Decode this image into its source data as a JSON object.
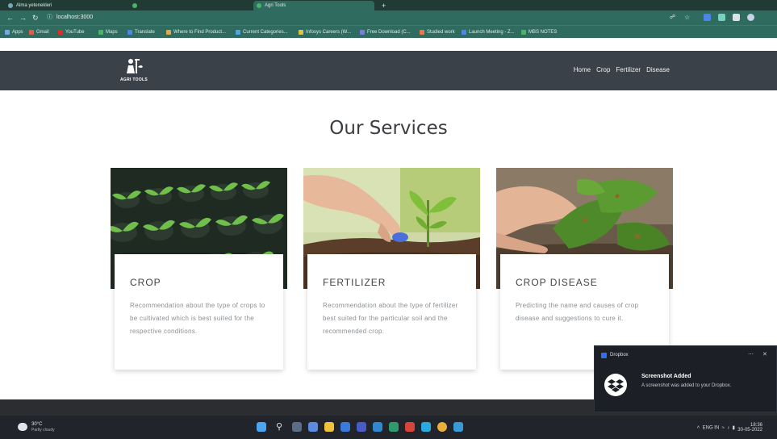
{
  "browser": {
    "tabs": [
      {
        "label": "Alma yetenekleri",
        "active": false
      },
      {
        "label": "",
        "active": false
      },
      {
        "label": "Agri Tools",
        "active": true
      }
    ],
    "url": "localhost:3000",
    "bookmarks": [
      {
        "label": "Apps",
        "color": "#7aa6e0"
      },
      {
        "label": "Gmail",
        "color": "#e05a4a"
      },
      {
        "label": "YouTube",
        "color": "#e02a2a"
      },
      {
        "label": "Maps",
        "color": "#4ab36a"
      },
      {
        "label": "Translate",
        "color": "#4a86e8"
      },
      {
        "label": "Where to Find Product...",
        "color": "#e0a84a"
      },
      {
        "label": "Current Categories...",
        "color": "#4aa8e0"
      },
      {
        "label": "Infosys Careers (W...",
        "color": "#e0c24a"
      },
      {
        "label": "Free Download (C...",
        "color": "#7a7ae0"
      },
      {
        "label": "Studied work",
        "color": "#e07a4a"
      },
      {
        "label": "Launch Meeting - Z...",
        "color": "#4a86e8"
      },
      {
        "label": "MBS NOTES",
        "color": "#4ab36a"
      }
    ]
  },
  "site": {
    "logo_text": "AGRI TOOLS",
    "nav": [
      "Home",
      "Crop",
      "Fertilizer",
      "Disease"
    ],
    "section_title": "Our Services",
    "cards": [
      {
        "title": "CROP",
        "image": "seedling-trays-image",
        "description": "Recommendation about the type of crops to be cultivated which is best suited for the respective conditions."
      },
      {
        "title": "FERTILIZER",
        "image": "hand-fertilizer-image",
        "description": "Recommendation about the type of fertilizer best suited for the particular soil and the recommended crop."
      },
      {
        "title": "CROP DISEASE",
        "image": "diseased-leaf-image",
        "description": "Predicting the name and causes of crop disease and suggestions to cure it."
      }
    ]
  },
  "taskbar": {
    "weather_temp": "30°C",
    "weather_desc": "Partly cloudy",
    "tray_lang": "ENG IN",
    "clock_time": "18:36",
    "clock_date": "30-05-2022"
  },
  "toast": {
    "app": "Dropbox",
    "title": "Screenshot Added",
    "text": "A screenshot was added to your Dropbox."
  }
}
